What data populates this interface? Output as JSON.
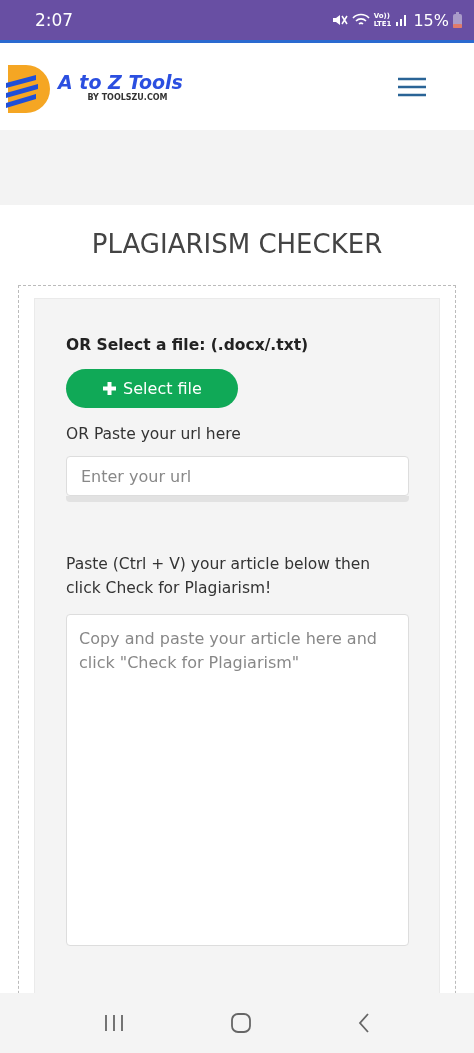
{
  "status_bar": {
    "time": "2:07",
    "volte": "Vo))",
    "network": "LTE1",
    "battery": "15%"
  },
  "header": {
    "logo_title": "A to Z Tools",
    "logo_subtitle": "BY TOOLSZU.COM"
  },
  "page": {
    "title": "PLAGIARISM CHECKER",
    "file_label": "OR Select a file: (.docx/.txt)",
    "file_button": "Select file",
    "url_label": "OR Paste your url here",
    "url_placeholder": "Enter your url",
    "article_label": "Paste (Ctrl + V) your article below then click Check for Plagiarism!",
    "article_placeholder": "Copy and paste your article here and click \"Check for Plagiarism\""
  }
}
